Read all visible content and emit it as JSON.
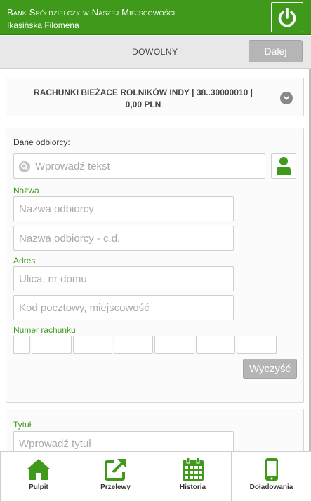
{
  "header": {
    "bank_name": "Bank Spółdzielczy w Naszej Miejscowości",
    "user_name": "Ikasińska Filomena",
    "logout_icon": "power-icon"
  },
  "toolbar": {
    "mode_label": "Dowolny",
    "next_label": "Dalej"
  },
  "account": {
    "line1": "RACHUNKI BIEŻACE ROLNIKÓW INDY | 38..30000010 |",
    "line2": "0,00 PLN"
  },
  "recipient": {
    "section_label": "Dane odbiorcy:",
    "search_placeholder": "Wprowadź tekst",
    "name_label": "Nazwa",
    "name_placeholder": "Nazwa odbiorcy",
    "name_cont_placeholder": "Nazwa odbiorcy - c.d.",
    "address_label": "Adres",
    "street_placeholder": "Ulica, nr domu",
    "city_placeholder": "Kod pocztowy, miejscowość",
    "account_label": "Numer rachunku",
    "clear_label": "Wyczyść"
  },
  "title_section": {
    "label": "Tytuł",
    "placeholder": "Wprowadź tytuł"
  },
  "bottom_nav": [
    {
      "label": "Pulpit",
      "icon": "home-icon"
    },
    {
      "label": "Przelewy",
      "icon": "transfer-icon"
    },
    {
      "label": "Historia",
      "icon": "calendar-icon"
    },
    {
      "label": "Doładowania",
      "icon": "phone-icon"
    }
  ],
  "colors": {
    "brand_green": "#3f9a1b",
    "button_grey": "#b5b5b5"
  }
}
